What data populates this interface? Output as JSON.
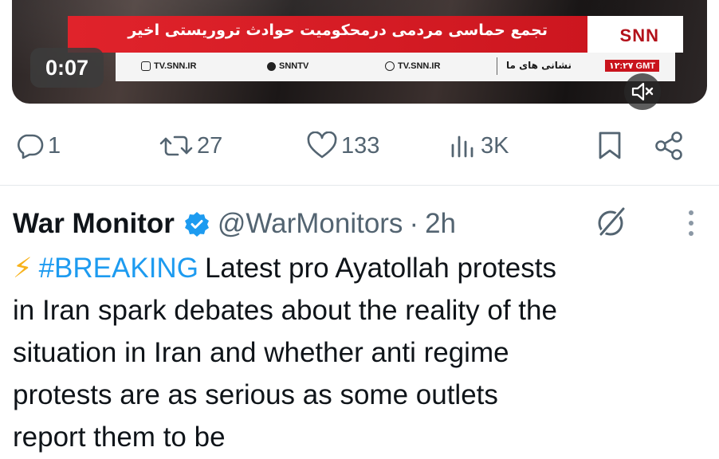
{
  "video": {
    "timestamp": "0:07",
    "banner_text": "تجمع حماسی مردمی درمحکومیت حوادث تروریستی اخیر",
    "logo": "SNN",
    "ticker": {
      "instagram": "TV.SNN.IR",
      "telegram": "SNNTV",
      "web": "TV.SNN.IR",
      "rtl_label": "نشانی های ما",
      "time": "۱۲:۲۷ GMT"
    },
    "mute_icon": "speaker-muted-icon"
  },
  "actions": {
    "reply_count": "1",
    "repost_count": "27",
    "like_count": "133",
    "view_count": "3K",
    "icons": [
      "reply-icon",
      "repost-icon",
      "like-icon",
      "views-icon",
      "bookmark-icon",
      "share-icon"
    ]
  },
  "tweet": {
    "author_name": "War Monitor",
    "handle": "@WarMonitors",
    "separator": "·",
    "age": "2h",
    "bolt": "⚡",
    "hashtag": "#BREAKING",
    "text": "Latest pro Ayatollah protests\nin Iran spark debates about the reality of the\nsituation in Iran and whether anti regime\nprotests are as serious as some outlets\nreport them to be",
    "colors": {
      "link": "#1d9bf0",
      "verified": "#1d9bf0",
      "secondary": "#536471"
    }
  }
}
